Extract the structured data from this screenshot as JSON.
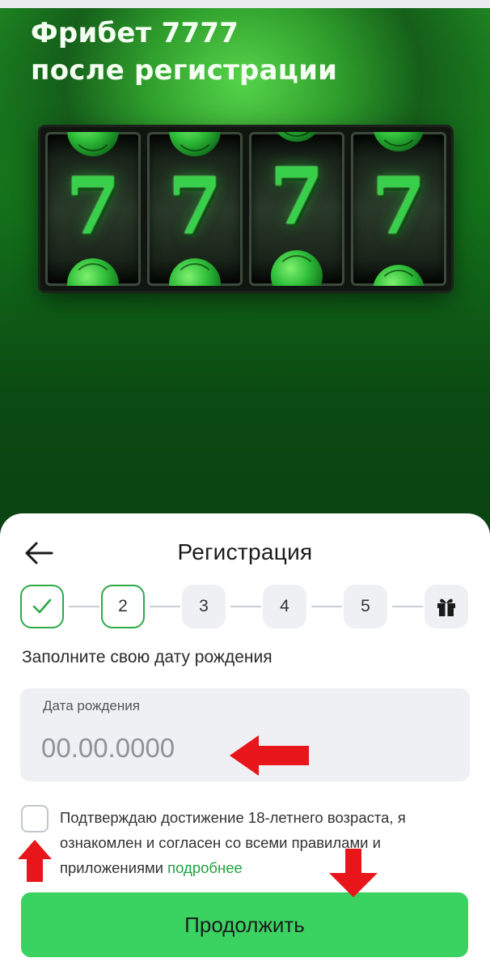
{
  "hero": {
    "title_line1": "Фрибет 7777",
    "title_line2": "после регистрации",
    "reels": [
      "7",
      "7",
      "7",
      "7"
    ]
  },
  "registration": {
    "title": "Регистрация",
    "steps": [
      {
        "label": "✓",
        "state": "done"
      },
      {
        "label": "2",
        "state": "active"
      },
      {
        "label": "3",
        "state": "pending"
      },
      {
        "label": "4",
        "state": "pending"
      },
      {
        "label": "5",
        "state": "pending"
      },
      {
        "label": "gift-icon",
        "state": "pending"
      }
    ],
    "hint": "Заполните свою дату рождения",
    "birthdate": {
      "label": "Дата рождения",
      "placeholder": "00.00.0000",
      "value": ""
    },
    "terms_text": "Подтверждаю достижение 18-летнего возраста, я ознакомлен и согласен со всеми правилами и приложениями",
    "terms_link": "подробнее",
    "continue_label": "Продолжить"
  },
  "colors": {
    "accent_green": "#3ad261",
    "link_green": "#1fa240",
    "annotation_red": "#e8161b"
  },
  "icons": [
    "back-arrow-icon",
    "check-icon",
    "gift-icon",
    "red-arrow-left-icon",
    "red-arrow-up-icon",
    "red-arrow-down-icon"
  ]
}
